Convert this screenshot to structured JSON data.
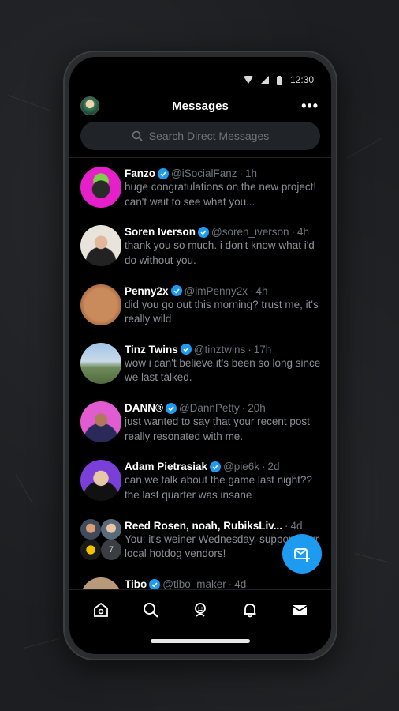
{
  "status": {
    "time": "12:30"
  },
  "header": {
    "title": "Messages",
    "more": "•••"
  },
  "search": {
    "placeholder": "Search Direct Messages"
  },
  "conversations": [
    {
      "name": "Fanzo",
      "verified": true,
      "handle": "@iSocialFanz",
      "time": "1h",
      "preview": "huge congratulations on the new project! can't wait to see what you...",
      "avatar": "magenta"
    },
    {
      "name": "Soren Iverson",
      "verified": true,
      "handle": "@soren_iverson",
      "time": "4h",
      "preview": "thank you so much. i don't know what i'd do without you.",
      "avatar": "beige"
    },
    {
      "name": "Penny2x",
      "verified": true,
      "handle": "@imPenny2x",
      "time": "4h",
      "preview": "did you go out this morning? trust me, it's really wild",
      "avatar": "penny"
    },
    {
      "name": "Tinz Twins",
      "verified": true,
      "handle": "@tinztwins",
      "time": "17h",
      "preview": "wow i can't believe it's been so long since we last talked.",
      "avatar": "sky"
    },
    {
      "name": "DANN®",
      "verified": true,
      "handle": "@DannPetty",
      "time": "20h",
      "preview": "just wanted to say that your recent post really resonated with me.",
      "avatar": "pink"
    },
    {
      "name": "Adam Pietrasiak",
      "verified": true,
      "handle": "@pie6k",
      "time": "2d",
      "preview": "can we talk about the game last night?? the last quarter was insane",
      "avatar": "purple"
    },
    {
      "name": "Reed Rosen, noah, RubiksLiv...",
      "verified": false,
      "handle": "",
      "time": "4d",
      "preview": "You: it's weiner Wednesday, support your local hotdog vendors!",
      "avatar": "group",
      "group_count": "7"
    },
    {
      "name": "Tibo",
      "verified": true,
      "handle": "@tibo_maker",
      "time": "4d",
      "preview": "",
      "avatar": "tan"
    }
  ],
  "colors": {
    "accent": "#1d9bf0",
    "background": "#000000",
    "muted": "#71767b"
  },
  "nav": [
    "home-icon",
    "search-icon",
    "spaces-icon",
    "notifications-icon",
    "messages-icon"
  ]
}
